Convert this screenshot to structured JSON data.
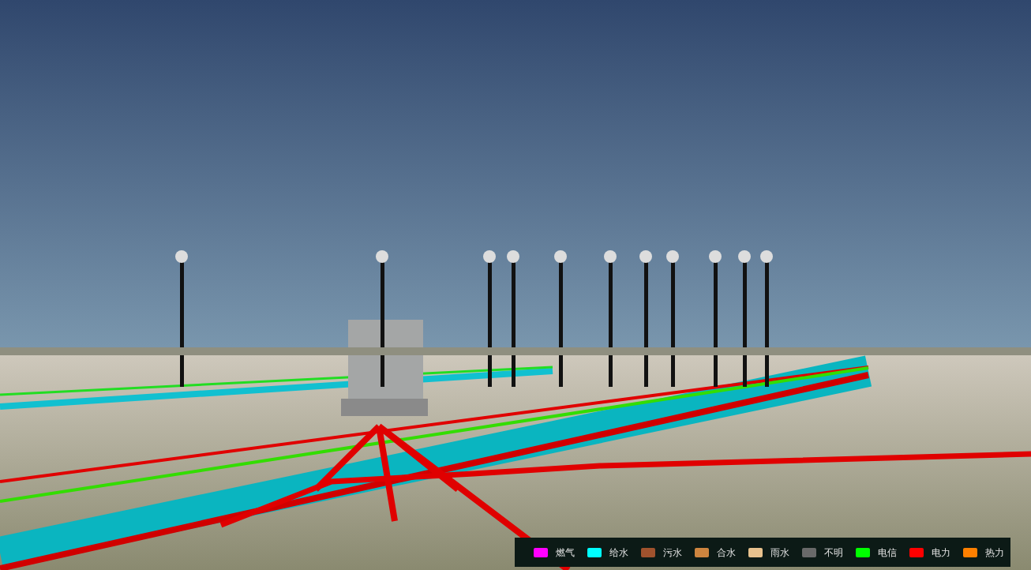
{
  "legend": {
    "items": [
      {
        "label": "燃气",
        "color": "#ff00ff"
      },
      {
        "label": "给水",
        "color": "#00ffff"
      },
      {
        "label": "污水",
        "color": "#a0522d"
      },
      {
        "label": "合水",
        "color": "#cd853f"
      },
      {
        "label": "雨水",
        "color": "#e8c28e"
      },
      {
        "label": "不明",
        "color": "#696969"
      },
      {
        "label": "电信",
        "color": "#00ff00"
      },
      {
        "label": "电力",
        "color": "#ff0000"
      },
      {
        "label": "热力",
        "color": "#ff8000"
      }
    ]
  }
}
